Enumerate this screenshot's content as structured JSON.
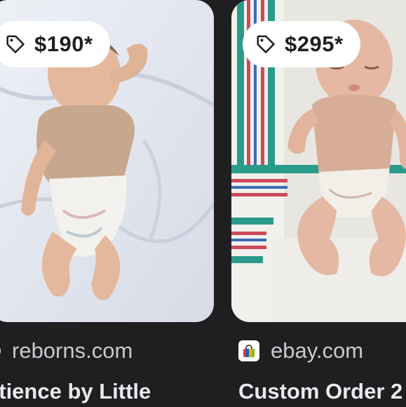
{
  "results": [
    {
      "price": "$190*",
      "source": "reborns.com",
      "title": "atience by Little",
      "image_alt": "reborn baby doll on white sheet"
    },
    {
      "price": "$295*",
      "source": "ebay.com",
      "title": "Custom Order 2",
      "image_alt": "reborn baby doll on striped hospital blanket"
    }
  ],
  "icons": {
    "price_tag": "tag-icon",
    "favicon_left": "reborns-favicon",
    "favicon_right": "ebay-shopping-bag-icon"
  },
  "colors": {
    "background": "#1f1f21",
    "chip_background": "#ffffff",
    "source_text": "#c8cacd",
    "title_text": "#e8eaed"
  }
}
